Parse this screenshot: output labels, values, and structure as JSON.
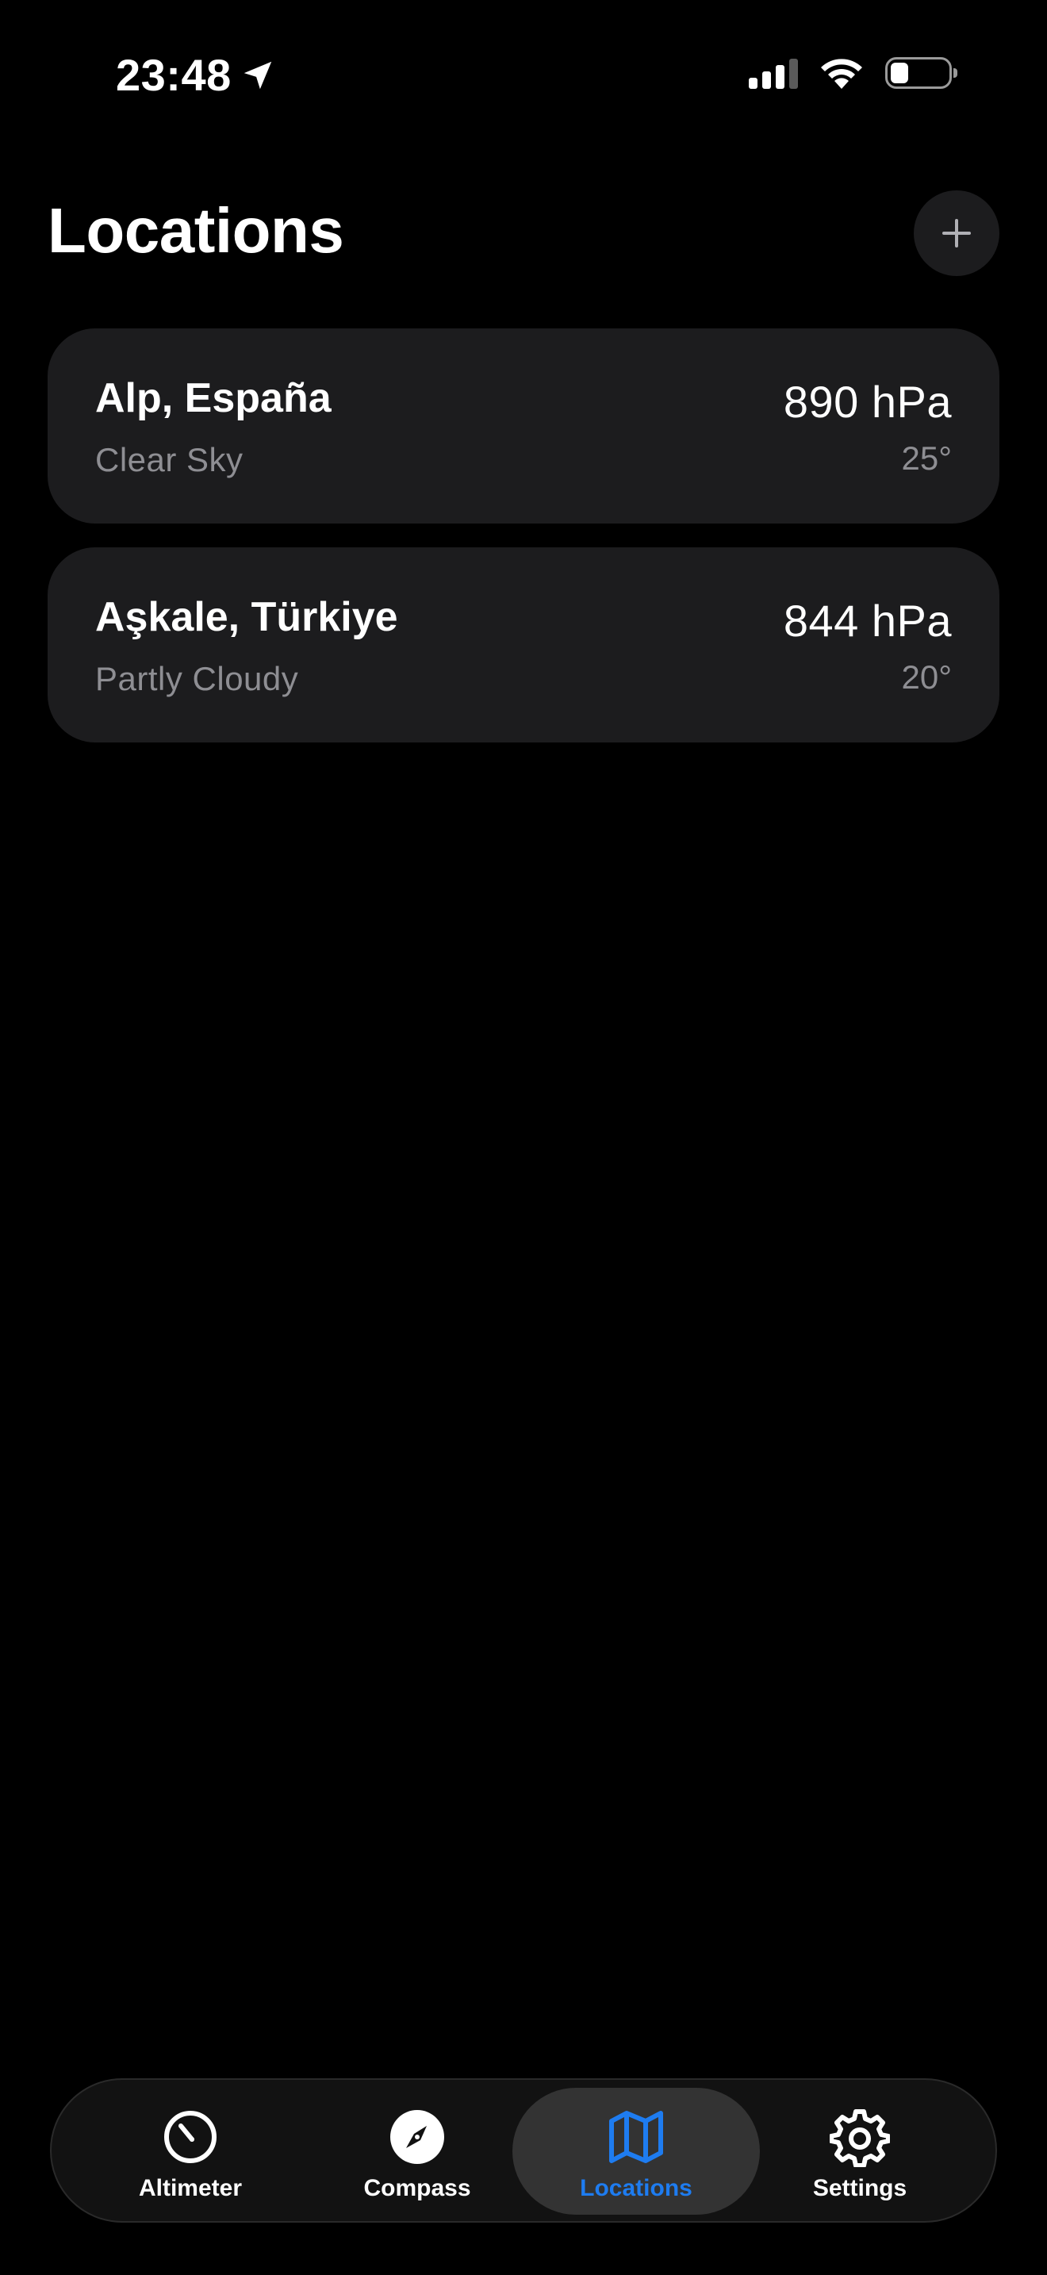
{
  "status_bar": {
    "time": "23:48"
  },
  "header": {
    "title": "Locations",
    "add_button_icon": "plus-icon"
  },
  "locations": [
    {
      "name": "Alp, España",
      "condition": "Clear Sky",
      "pressure": "890 hPa",
      "temperature": "25°"
    },
    {
      "name": "Aşkale, Türkiye",
      "condition": "Partly Cloudy",
      "pressure": "844 hPa",
      "temperature": "20°"
    }
  ],
  "tab_bar": {
    "tabs": [
      {
        "label": "Altimeter",
        "icon": "gauge-icon",
        "active": false
      },
      {
        "label": "Compass",
        "icon": "compass-icon",
        "active": false
      },
      {
        "label": "Locations",
        "icon": "map-icon",
        "active": true
      },
      {
        "label": "Settings",
        "icon": "gear-icon",
        "active": false
      }
    ]
  },
  "colors": {
    "background": "#000000",
    "card": "#1c1c1e",
    "secondary_text": "#8e8e93",
    "accent": "#1e7cf0"
  }
}
